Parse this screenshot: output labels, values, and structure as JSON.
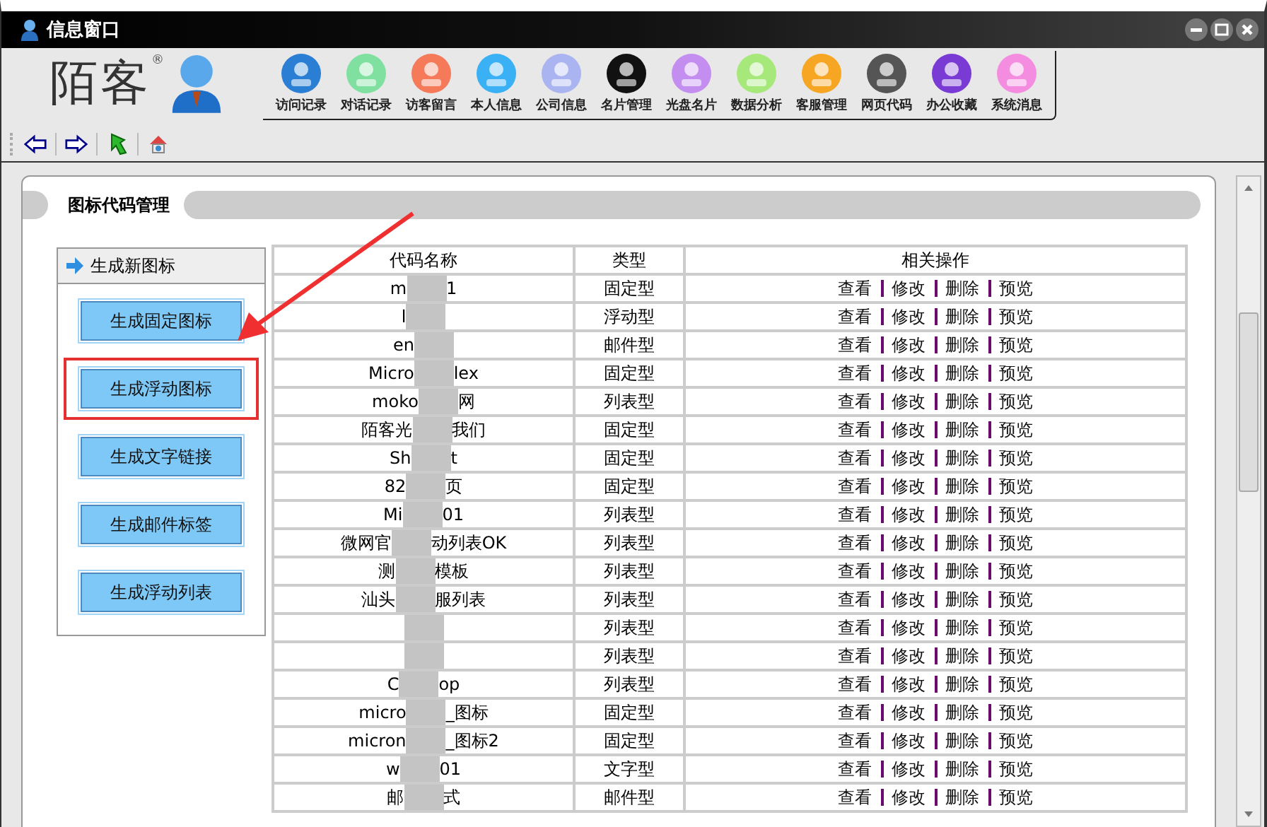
{
  "window": {
    "title": "信息窗口"
  },
  "logo": {
    "text": "陌客",
    "mark": "®"
  },
  "nav": [
    {
      "label": "访问记录",
      "color": "#2a7fd4"
    },
    {
      "label": "对话记录",
      "color": "#7fe0a0"
    },
    {
      "label": "访客留言",
      "color": "#f47a5a"
    },
    {
      "label": "本人信息",
      "color": "#3ab0f5"
    },
    {
      "label": "公司信息",
      "color": "#aab4f0"
    },
    {
      "label": "名片管理",
      "color": "#111111"
    },
    {
      "label": "光盘名片",
      "color": "#c48ef0"
    },
    {
      "label": "数据分析",
      "color": "#a6e87a"
    },
    {
      "label": "客服管理",
      "color": "#f7a623"
    },
    {
      "label": "网页代码",
      "color": "#555555"
    },
    {
      "label": "办公收藏",
      "color": "#7a3ad4"
    },
    {
      "label": "系统消息",
      "color": "#f48ce0"
    }
  ],
  "section": {
    "title": "图标代码管理"
  },
  "side_panel": {
    "title": "生成新图标",
    "buttons": [
      {
        "label": "生成固定图标",
        "highlighted": false
      },
      {
        "label": "生成浮动图标",
        "highlighted": true
      },
      {
        "label": "生成文字链接",
        "highlighted": false
      },
      {
        "label": "生成邮件标签",
        "highlighted": false
      },
      {
        "label": "生成浮动列表",
        "highlighted": false
      }
    ]
  },
  "table": {
    "columns": [
      "代码名称",
      "类型",
      "相关操作"
    ],
    "rows": [
      {
        "name_start": "m",
        "name_end": "1",
        "type": "固定型",
        "actions": [
          "查看",
          "修改",
          "删除",
          "预览"
        ]
      },
      {
        "name_start": "l",
        "name_end": "",
        "type": "浮动型",
        "actions": [
          "查看",
          "修改",
          "删除",
          "预览"
        ]
      },
      {
        "name_start": "en",
        "name_end": "",
        "type": "邮件型",
        "actions": [
          "查看",
          "修改",
          "删除",
          "预览"
        ]
      },
      {
        "name_start": "Micro",
        "name_end": "lex",
        "type": "固定型",
        "actions": [
          "查看",
          "修改",
          "删除",
          "预览"
        ]
      },
      {
        "name_start": "moko",
        "name_end": "网",
        "type": "列表型",
        "actions": [
          "查看",
          "修改",
          "删除",
          "预览"
        ]
      },
      {
        "name_start": "陌客光",
        "name_end": "我们",
        "type": "固定型",
        "actions": [
          "查看",
          "修改",
          "删除",
          "预览"
        ]
      },
      {
        "name_start": "Sh",
        "name_end": "t",
        "type": "固定型",
        "actions": [
          "查看",
          "修改",
          "删除",
          "预览"
        ]
      },
      {
        "name_start": "82",
        "name_end": "页",
        "type": "固定型",
        "actions": [
          "查看",
          "修改",
          "删除",
          "预览"
        ]
      },
      {
        "name_start": "Mi",
        "name_end": "01",
        "type": "列表型",
        "actions": [
          "查看",
          "修改",
          "删除",
          "预览"
        ]
      },
      {
        "name_start": "微网官",
        "name_end": "动列表OK",
        "type": "列表型",
        "actions": [
          "查看",
          "修改",
          "删除",
          "预览"
        ]
      },
      {
        "name_start": "测",
        "name_end": "模板",
        "type": "列表型",
        "actions": [
          "查看",
          "修改",
          "删除",
          "预览"
        ]
      },
      {
        "name_start": "汕头",
        "name_end": "服列表",
        "type": "列表型",
        "actions": [
          "查看",
          "修改",
          "删除",
          "预览"
        ]
      },
      {
        "name_start": "",
        "name_end": "",
        "type": "列表型",
        "actions": [
          "查看",
          "修改",
          "删除",
          "预览"
        ]
      },
      {
        "name_start": "",
        "name_end": "",
        "type": "列表型",
        "actions": [
          "查看",
          "修改",
          "删除",
          "预览"
        ]
      },
      {
        "name_start": "C",
        "name_end": "op",
        "type": "列表型",
        "actions": [
          "查看",
          "修改",
          "删除",
          "预览"
        ]
      },
      {
        "name_start": "micro",
        "name_end": "_图标",
        "type": "固定型",
        "actions": [
          "查看",
          "修改",
          "删除",
          "预览"
        ]
      },
      {
        "name_start": "micron",
        "name_end": "_图标2",
        "type": "固定型",
        "actions": [
          "查看",
          "修改",
          "删除",
          "预览"
        ]
      },
      {
        "name_start": "w",
        "name_end": "01",
        "type": "文字型",
        "actions": [
          "查看",
          "修改",
          "删除",
          "预览"
        ]
      },
      {
        "name_start": "邮",
        "name_end": "式",
        "type": "邮件型",
        "actions": [
          "查看",
          "修改",
          "删除",
          "预览"
        ]
      }
    ]
  }
}
